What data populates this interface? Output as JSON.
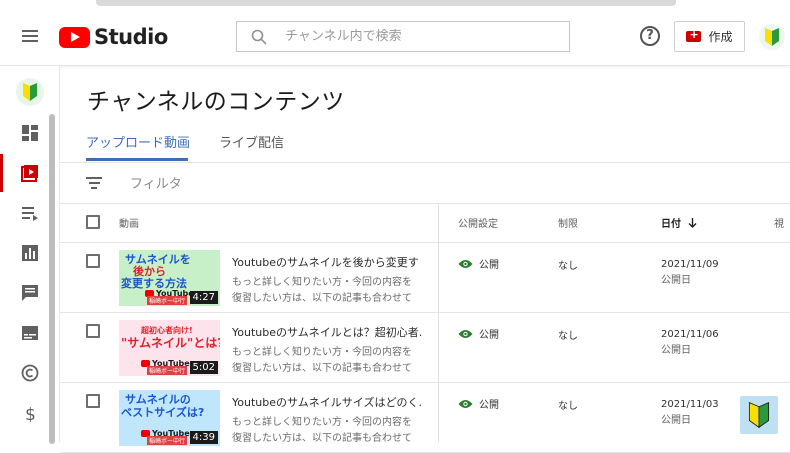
{
  "header": {
    "logo_text": "Studio",
    "search_placeholder": "チャンネル内で検索",
    "help_label": "?",
    "create_label": "作成"
  },
  "page": {
    "title": "チャンネルのコンテンツ",
    "tabs": [
      {
        "label": "アップロード動画",
        "active": true
      },
      {
        "label": "ライブ配信",
        "active": false
      }
    ],
    "filter_label": "フィルタ"
  },
  "table": {
    "headers": {
      "video": "動画",
      "visibility": "公開設定",
      "restrictions": "制限",
      "date": "日付",
      "views_partial": "視"
    },
    "rows": [
      {
        "thumb_lines": [
          "サムネイルを",
          "後から",
          "変更する方法"
        ],
        "thumb_brand": "YouTube",
        "thumb_tag": "稲崎ボー中行",
        "duration": "4:27",
        "title": "Youtubeのサムネイルを後から変更す",
        "desc1": "もっと詳しく知りたい方・今回の内容を",
        "desc2": "復習したい方は、以下の記事も合わせて",
        "visibility": "公開",
        "restriction": "なし",
        "date": "2021/11/09",
        "date_sub": "公開日"
      },
      {
        "thumb_lines": [
          "超初心者向け!",
          "\"サムネイル\"とは?"
        ],
        "thumb_brand": "YouTube",
        "thumb_tag": "稲崎ボー中行",
        "duration": "5:02",
        "title": "Youtubeのサムネイルとは？超初心者...",
        "desc1": "もっと詳しく知りたい方・今回の内容を",
        "desc2": "復習したい方は、以下の記事も合わせて",
        "visibility": "公開",
        "restriction": "なし",
        "date": "2021/11/06",
        "date_sub": "公開日"
      },
      {
        "thumb_lines": [
          "サムネイルの",
          "ベストサイズは?"
        ],
        "thumb_brand": "YouTube",
        "thumb_tag": "稲崎ボー中行",
        "duration": "4:39",
        "title": "Youtubeのサムネイルサイズはどのく...",
        "desc1": "もっと詳しく知りたい方・今回の内容を",
        "desc2": "復習したい方は、以下の記事も合わせて",
        "visibility": "公開",
        "restriction": "なし",
        "date": "2021/11/03",
        "date_sub": "公開日"
      }
    ]
  },
  "colors": {
    "brand_red": "#ff0000",
    "accent_blue": "#3d6fb5",
    "public_green": "#2e7d32"
  }
}
